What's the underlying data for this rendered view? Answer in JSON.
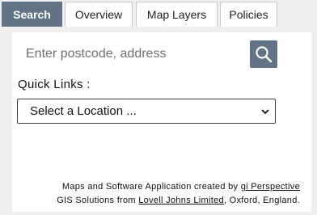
{
  "tabs": [
    {
      "label": "Search",
      "active": true
    },
    {
      "label": "Overview",
      "active": false
    },
    {
      "label": "Map Layers",
      "active": false
    },
    {
      "label": "Policies",
      "active": false
    }
  ],
  "search": {
    "placeholder": "Enter postcode, address",
    "value": "",
    "button_icon": "search-icon"
  },
  "quick_links": {
    "label": "Quick Links :",
    "selected": "Select a Location ..."
  },
  "credits": {
    "line1_prefix": "Maps and Software Application created by",
    "line1_link": "gi Perspective",
    "line2_prefix": "GIS Solutions from",
    "line2_link": "Lovell Johns Limited",
    "line2_suffix": ", Oxford, England."
  },
  "colors": {
    "accent": "#627386",
    "background": "#efefef",
    "panel": "#ffffff"
  }
}
